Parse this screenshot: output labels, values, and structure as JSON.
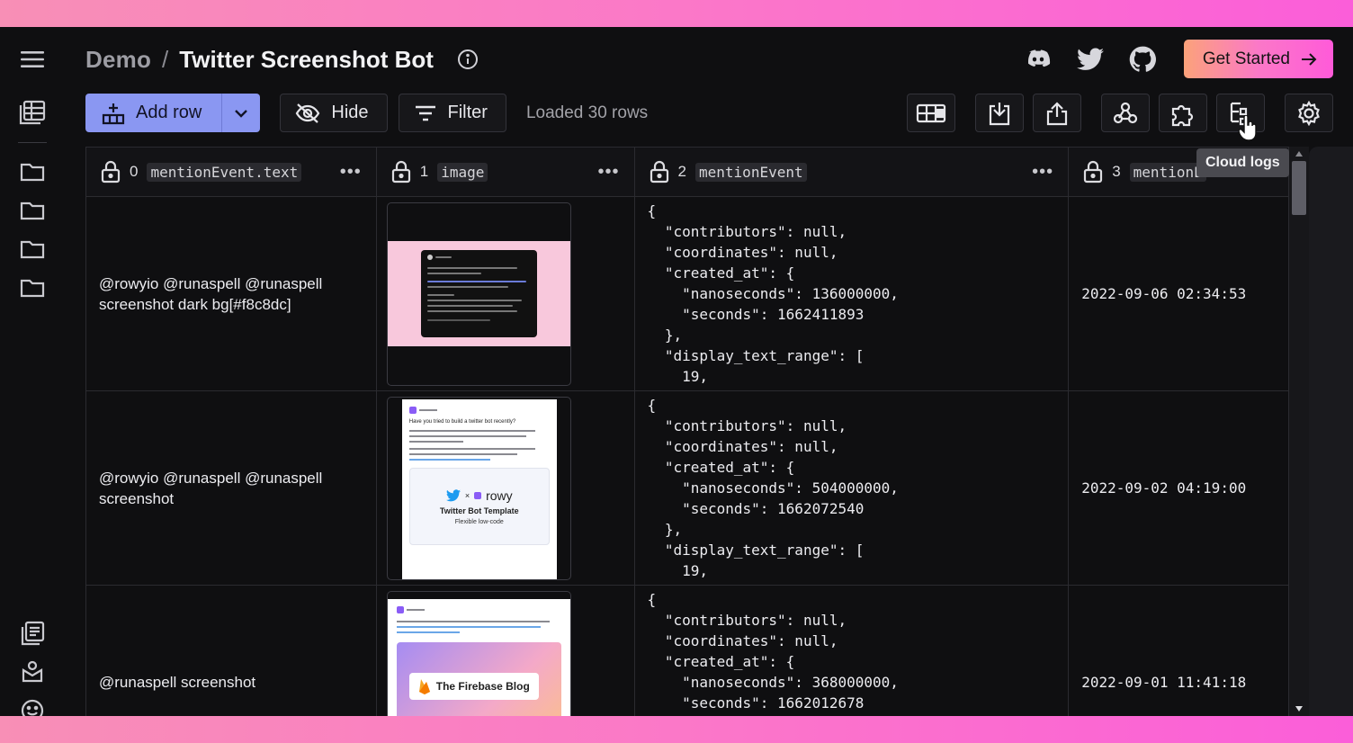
{
  "header": {
    "breadcrumb_root": "Demo",
    "breadcrumb_sep": "/",
    "title": "Twitter Screenshot Bot",
    "get_started": "Get Started"
  },
  "toolbar": {
    "add_row": "Add row",
    "hide": "Hide",
    "filter": "Filter",
    "status": "Loaded 30 rows",
    "tooltip": "Cloud logs"
  },
  "columns": [
    {
      "index": "0",
      "key": "mentionEvent.text"
    },
    {
      "index": "1",
      "key": "image"
    },
    {
      "index": "2",
      "key": "mentionEvent"
    },
    {
      "index": "3",
      "key": "mentionE"
    }
  ],
  "rows": [
    {
      "text": "@rowyio @runaspell @runaspell screenshot dark bg[#f8c8dc]",
      "json": "{\n  \"contributors\": null,\n  \"coordinates\": null,\n  \"created_at\": {\n    \"nanoseconds\": 136000000,\n    \"seconds\": 1662411893\n  },\n  \"display_text_range\": [\n    19,",
      "date": "2022-09-06 02:34:53"
    },
    {
      "text": "@rowyio @runaspell @runaspell screenshot",
      "json": "{\n  \"contributors\": null,\n  \"coordinates\": null,\n  \"created_at\": {\n    \"nanoseconds\": 504000000,\n    \"seconds\": 1662072540\n  },\n  \"display_text_range\": [\n    19,",
      "date": "2022-09-02 04:19:00"
    },
    {
      "text": "@runaspell screenshot",
      "json": "{\n  \"contributors\": null,\n  \"coordinates\": null,\n  \"created_at\": {\n    \"nanoseconds\": 368000000,\n    \"seconds\": 1662012678",
      "date": "2022-09-01 11:41:18"
    }
  ],
  "thumbnails": {
    "t2_question": "Have you tried to build a twitter bot recently?",
    "t2_brand": "rowy",
    "t2_title": "Twitter Bot Template",
    "t2_sub": "Flexible low-code",
    "t3_title": "The Firebase Blog"
  }
}
